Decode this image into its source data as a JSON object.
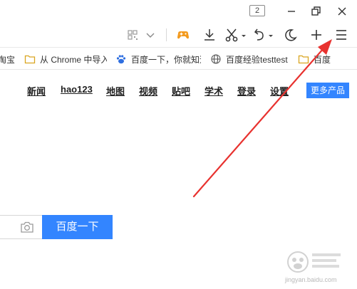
{
  "titlebar": {
    "tab_count": "2",
    "icons": [
      "minimize-icon",
      "restore-icon",
      "close-icon"
    ]
  },
  "toolbar": {
    "icons": [
      "qr-code-icon",
      "chevron-down-icon",
      "gamepad-icon",
      "download-icon",
      "scissors-icon",
      "undo-icon",
      "moon-icon",
      "plus-icon",
      "menu-icon"
    ]
  },
  "bookmarks": {
    "items": [
      {
        "label": "淘宝",
        "icon": "none"
      },
      {
        "label": "从 Chrome 中导入",
        "icon": "folder-icon"
      },
      {
        "label": "百度一下，你就知道",
        "icon": "paw-icon"
      },
      {
        "label": "百度经验testtest",
        "icon": "globe-icon"
      },
      {
        "label": "百度",
        "icon": "folder-icon"
      }
    ]
  },
  "nav": {
    "links": [
      "新闻",
      "hao123",
      "地图",
      "视频",
      "贴吧",
      "学术",
      "登录",
      "设置"
    ],
    "more": "更多产品"
  },
  "search": {
    "button": "百度一下"
  },
  "watermark": {
    "text": "jingyan.baidu.com"
  },
  "colors": {
    "accent": "#3385ff",
    "arrow": "#e8322f",
    "game_icon": "#f39a1e"
  }
}
